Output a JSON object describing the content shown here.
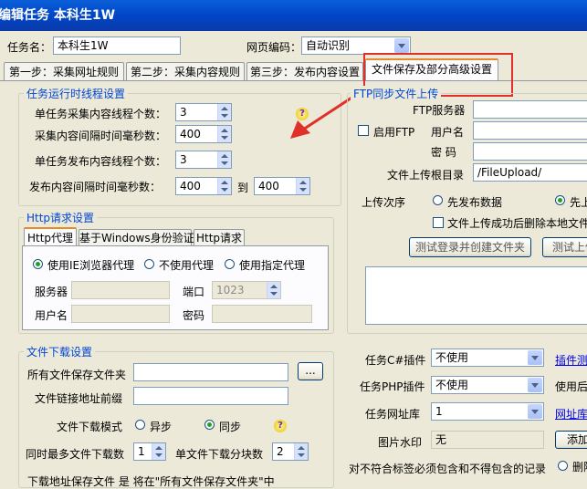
{
  "window": {
    "title": "编辑任务   本科生1W"
  },
  "top": {
    "task_name_label": "任务名：",
    "task_name_value": "本科生1W",
    "encoding_label": "网页编码：",
    "encoding_value": "自动识别"
  },
  "tabs": [
    {
      "label": "第一步：采集网址规则"
    },
    {
      "label": "第二步：采集内容规则"
    },
    {
      "label": "第三步：发布内容设置"
    },
    {
      "label": "文件保存及部分高级设置"
    }
  ],
  "thread": {
    "title": "任务运行时线程设置",
    "r1_label": "单任务采集内容线程个数：",
    "r1_value": "3",
    "r2_label": "采集内容间隔时间毫秒数：",
    "r2_value": "400",
    "r3_label": "单任务发布内容线程个数：",
    "r3_value": "3",
    "r4_label": "发布内容间隔时间毫秒数：",
    "r4_from": "400",
    "r4_to_label": "到",
    "r4_to": "400"
  },
  "http": {
    "title": "Http请求设置",
    "tabs": [
      "Http代理",
      "基于Windows身份验证",
      "Http请求"
    ],
    "radio1": "使用IE浏览器代理",
    "radio2": "不使用代理",
    "radio3": "使用指定代理",
    "server_label": "服务器",
    "port_label": "端口",
    "port_value": "1023",
    "user_label": "用户名",
    "pwd_label": "密码"
  },
  "download": {
    "title": "文件下载设置",
    "folder_label": "所有文件保存文件夹",
    "browse_label": "...",
    "prefix_label": "文件链接地址前缀",
    "mode_label": "文件下载模式",
    "mode_async": "异步",
    "mode_sync": "同步",
    "max_label": "同时最多文件下载数",
    "max_value": "1",
    "chunks_label": "单文件下载分块数",
    "chunks_value": "2",
    "bottom_text": "下载地址保存文件  是  将在\"所有文件保存文件夹\"中"
  },
  "ftp": {
    "title": "FTP同步文件上传",
    "server_label": "FTP服务器",
    "enable_label": "启用FTP",
    "user_label": "用户名",
    "pwd_label": "密  码",
    "root_label": "文件上传根目录",
    "root_value": "/FileUpload/",
    "order_label": "上传次序",
    "order_opt1": "先发布数据",
    "order_opt2": "先上",
    "delete_label": "文件上传成功后删除本地文件",
    "btn_test": "测试登录并创建文件夹",
    "btn_test2": "测试上传"
  },
  "plugins": {
    "cs_label": "任务C#插件",
    "cs_value": "不使用",
    "cs_link": "插件测",
    "php_label": "任务PHP插件",
    "php_value": "不使用",
    "php_side": "使用后",
    "url_label": "任务网址库",
    "url_value": "1",
    "url_link": "网址库",
    "wm_label": "图片水印",
    "wm_value": "无",
    "wm_btn": "添加",
    "rule_label": "对不符合标签必须包含和不得包含的记录",
    "rule_opt": "删除"
  },
  "colors": {
    "accent": "#e68b2c",
    "title_blue": "#0046d5",
    "highlight_red": "#e0302a"
  },
  "icons": {
    "help": "question-icon",
    "arrow": "red-arrow"
  }
}
